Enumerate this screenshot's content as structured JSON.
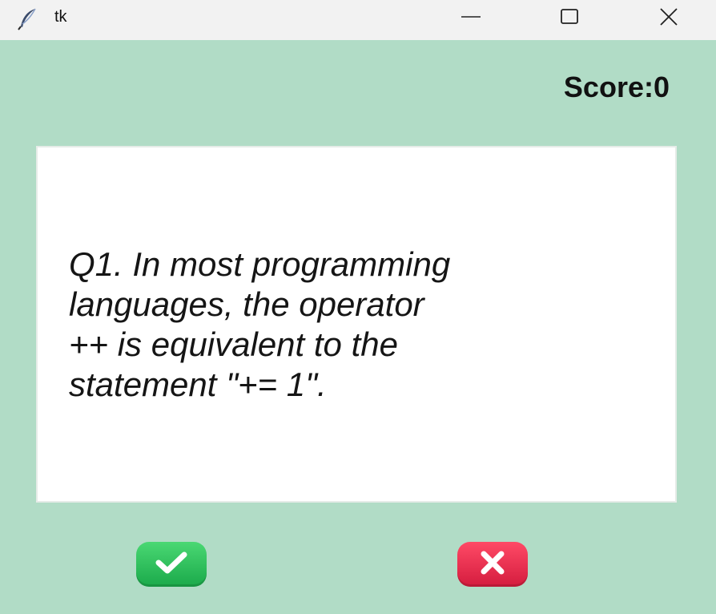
{
  "window": {
    "title": "tk",
    "icon": "feather-icon",
    "controls": [
      "minimize-icon",
      "maximize-icon",
      "close-icon"
    ]
  },
  "score": {
    "text": "Score:0"
  },
  "question": {
    "text": "Q1. In most programming\nlanguages, the operator\n++ is equivalent to the\nstatement \"+= 1\"."
  },
  "buttons": {
    "true_icon": "check-icon",
    "false_icon": "x-icon"
  },
  "colors": {
    "background": "#b1dcc6",
    "card": "#ffffff",
    "true_button": "#22b550",
    "false_button": "#e52c4d"
  }
}
